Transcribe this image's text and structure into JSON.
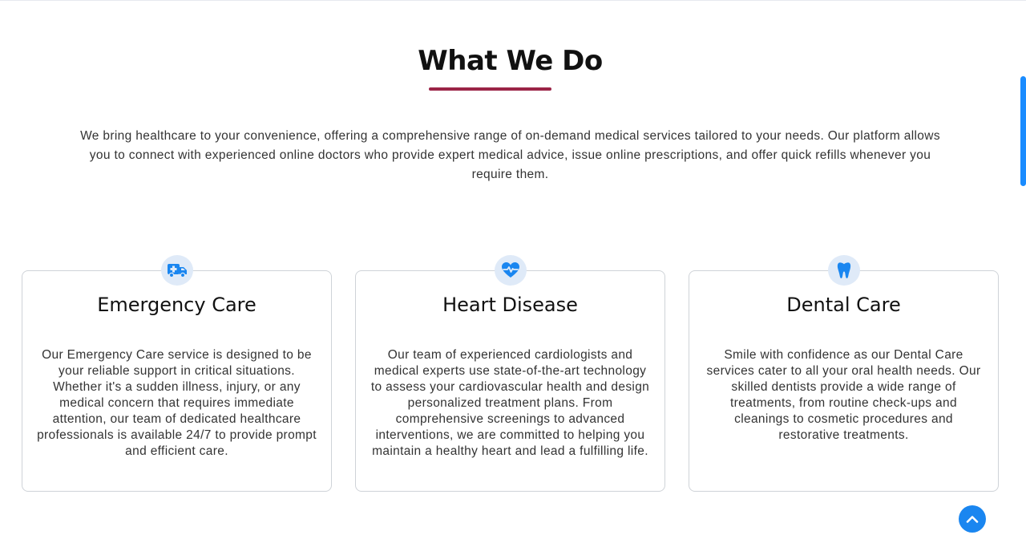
{
  "section": {
    "title": "What We Do",
    "intro": "We bring healthcare to your convenience, offering a comprehensive range of on-demand medical services tailored to your needs. Our platform allows you to connect with experienced online doctors who provide expert medical advice, issue online prescriptions, and offer quick refills whenever you require them."
  },
  "colors": {
    "accent_underline": "#9b2447",
    "icon_blue": "#1a86f0",
    "icon_bg": "#dfeaf8"
  },
  "cards": [
    {
      "icon": "ambulance-icon",
      "title": "Emergency Care",
      "text": "Our Emergency Care service is designed to be your reliable support in critical situations. Whether it's a sudden illness, injury, or any medical concern that requires immediate attention, our team of dedicated healthcare professionals is available 24/7 to provide prompt and efficient care."
    },
    {
      "icon": "heart-pulse-icon",
      "title": "Heart Disease",
      "text": "Our team of experienced cardiologists and medical experts use state-of-the-art technology to assess your cardiovascular health and design personalized treatment plans. From comprehensive screenings to advanced interventions, we are committed to helping you maintain a healthy heart and lead a fulfilling life."
    },
    {
      "icon": "tooth-icon",
      "title": "Dental Care",
      "text": "Smile with confidence as our Dental Care services cater to all your oral health needs. Our skilled dentists provide a wide range of treatments, from routine check-ups and cleanings to cosmetic procedures and restorative treatments."
    }
  ],
  "controls": {
    "back_to_top_icon": "chevron-up-icon"
  }
}
